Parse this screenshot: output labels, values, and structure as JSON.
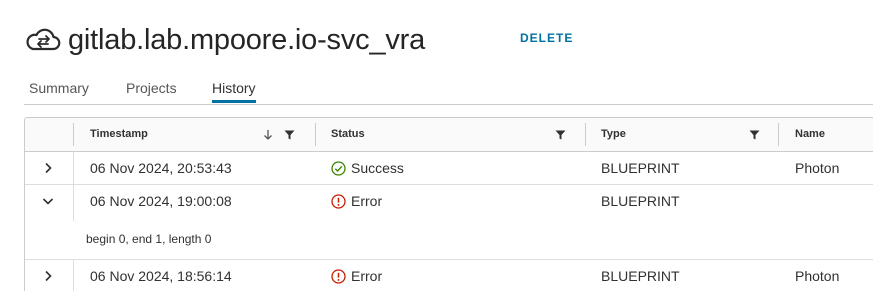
{
  "header": {
    "title": "gitlab.lab.mpoore.io-svc_vra",
    "icon": "cloud-sync-icon",
    "delete_label": "DELETE"
  },
  "tabs": [
    {
      "label": "Summary",
      "active": false
    },
    {
      "label": "Projects",
      "active": false
    },
    {
      "label": "History",
      "active": true
    }
  ],
  "table": {
    "columns": {
      "timestamp": "Timestamp",
      "status": "Status",
      "type": "Type",
      "name": "Name"
    },
    "sort": {
      "column": "Timestamp",
      "direction": "descending"
    },
    "rows": [
      {
        "timestamp": "06 Nov 2024, 20:53:43",
        "status": "Success",
        "status_icon": "check-circle-icon",
        "type": "BLUEPRINT",
        "name": "Photon",
        "expanded": false
      },
      {
        "timestamp": "06 Nov 2024, 19:00:08",
        "status": "Error",
        "status_icon": "exclamation-circle-icon",
        "type": "BLUEPRINT",
        "name": "",
        "expanded": true,
        "detail": "begin 0, end 1, length 0"
      },
      {
        "timestamp": "06 Nov 2024, 18:56:14",
        "status": "Error",
        "status_icon": "exclamation-circle-icon",
        "type": "BLUEPRINT",
        "name": "Photon",
        "expanded": false
      }
    ]
  },
  "colors": {
    "accent": "#0072a3",
    "success": "#3c8500",
    "error": "#c21d00",
    "border": "#cccccc",
    "header_bg": "#fafafa"
  }
}
